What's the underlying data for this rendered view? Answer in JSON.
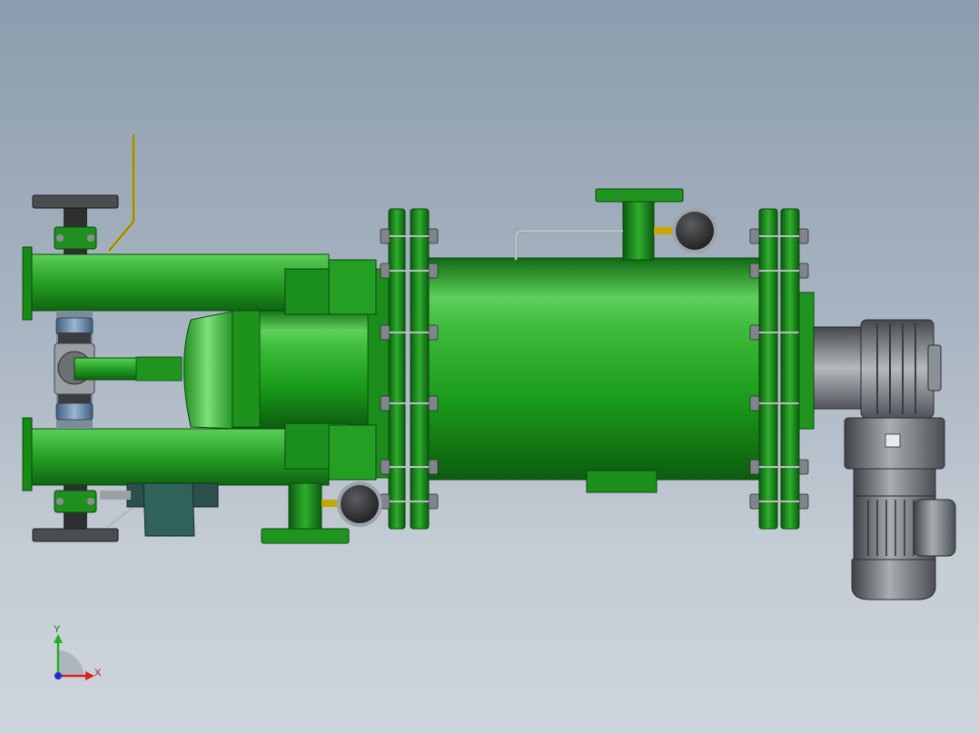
{
  "viewport": {
    "background_top": "#8c9cae",
    "background_bottom": "#cfd5dc"
  },
  "model": {
    "parts": [
      "inlet-outlet-pipes",
      "filter-housing",
      "flanges",
      "bolts",
      "pressure-gauges",
      "ball-valves",
      "gear-motor"
    ],
    "colors": {
      "body_green": "#22a022",
      "body_green_dark": "#0e6410",
      "body_green_light": "#7ed97a",
      "gauge_dark": "#2d2d2d",
      "bolt_grey": "#8a8f94",
      "motor_grey": "#7a7f84",
      "pipe_blue": "#6f8fae",
      "lever_yellow": "#c8b400"
    }
  },
  "triad": {
    "x_label": "X",
    "y_label": "Y",
    "x_color": "#e02020",
    "y_color": "#20b020",
    "z_color": "#2030d0"
  }
}
